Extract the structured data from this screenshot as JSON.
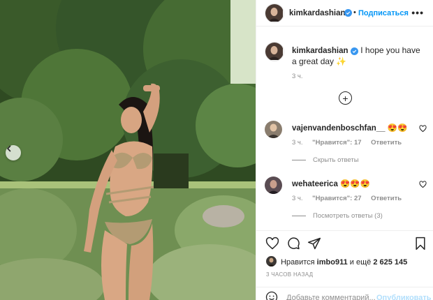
{
  "header": {
    "username": "kimkardashian",
    "separator": "•",
    "follow_label": "Подписаться",
    "more_label": "•••"
  },
  "caption": {
    "username": "kimkardashian",
    "text": "I hope you have a great day ✨",
    "time": "3 ч."
  },
  "comments": [
    {
      "username": "vajenvandenboschfan__",
      "emoji": "😍😍",
      "time": "3 ч.",
      "likes": "\"Нравится\": 17",
      "reply": "Ответить",
      "thread_toggle": "Скрыть ответы"
    },
    {
      "username": "wehateerica",
      "emoji": "😍😍😍",
      "time": "3 ч.",
      "likes": "\"Нравится\": 27",
      "reply": "Ответить",
      "thread_toggle": "Посмотреть ответы (3)"
    }
  ],
  "actions": {
    "likes_prefix": "Нравится",
    "liker": "imbo911",
    "likes_mid": "и ещё",
    "likes_count": "2 625 145",
    "post_time": "3 ЧАСОВ НАЗАД"
  },
  "add_comment": {
    "placeholder": "Добавьте комментарий...",
    "publish_label": "Опубликовать"
  },
  "icons": {
    "verified": "verified-badge-icon",
    "prev": "chevron-left-icon",
    "add": "plus-circle-icon",
    "heart": "heart-icon",
    "comment": "comment-icon",
    "share": "paper-plane-icon",
    "save": "bookmark-icon",
    "more": "more-horizontal-icon",
    "emoji": "emoji-icon"
  },
  "colors": {
    "link_blue": "#0095f6",
    "verified_blue": "#3897f0",
    "muted": "#8e8e8e",
    "publish_disabled": "#b2dffc"
  }
}
